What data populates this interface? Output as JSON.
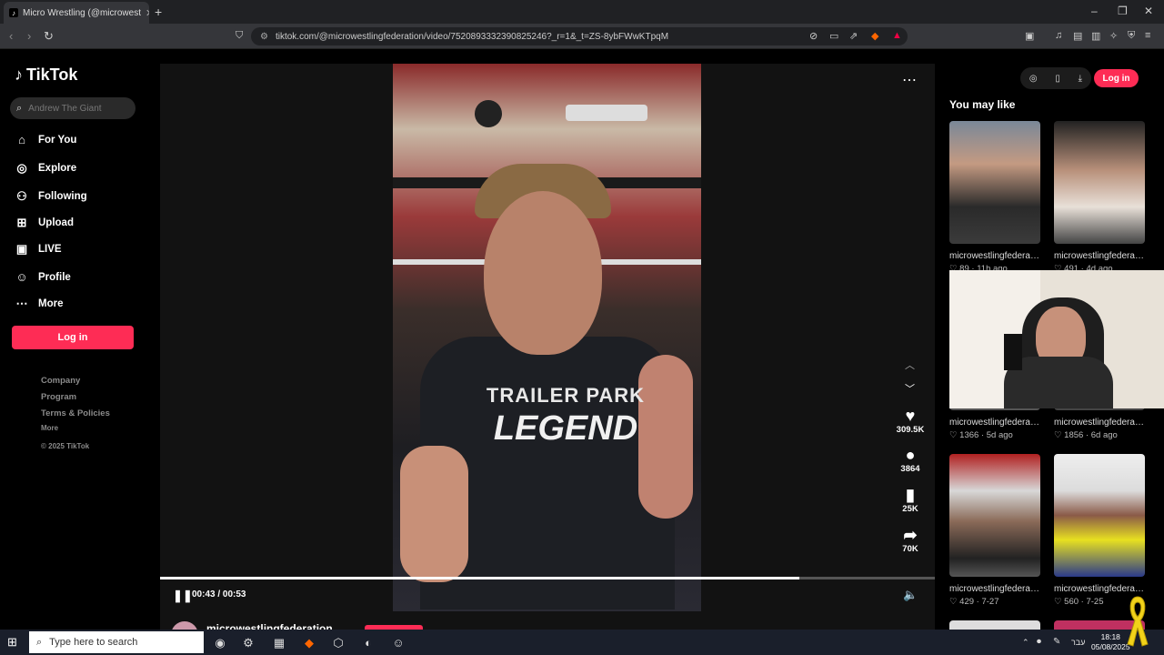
{
  "browser": {
    "tab_title": "Micro Wrestling (@microwest",
    "url": "tiktok.com/@microwestlingfederation/video/7520893332390825246?_r=1&_t=ZS-8ybFWwKTpqM"
  },
  "sidebar": {
    "brand": "TikTok",
    "search_placeholder": "Andrew The Giant",
    "nav": [
      {
        "label": "For You",
        "icon": "home-icon"
      },
      {
        "label": "Explore",
        "icon": "compass-icon"
      },
      {
        "label": "Following",
        "icon": "person-icon"
      },
      {
        "label": "Upload",
        "icon": "plus-square-icon"
      },
      {
        "label": "LIVE",
        "icon": "tv-icon"
      },
      {
        "label": "Profile",
        "icon": "profile-icon"
      },
      {
        "label": "More",
        "icon": "dots-icon"
      }
    ],
    "login_label": "Log in",
    "footer": [
      "Company",
      "Program",
      "Terms & Policies",
      "More",
      "© 2025 TikTok"
    ]
  },
  "video": {
    "shirt_line1": "TRAILER PARK",
    "shirt_line2": "LEGEND",
    "likes": "309.5K",
    "comments": "3864",
    "saves": "25K",
    "shares": "70K",
    "time": "00:43 / 00:53",
    "progress_fraction": 0.825,
    "author": "microwestlingfederation"
  },
  "right": {
    "login_label": "Log in",
    "heading": "You may like",
    "cards": [
      {
        "title": "microwestlingfederati...",
        "likes": "89",
        "ago": "11h ago"
      },
      {
        "title": "microwestlingfederati...",
        "likes": "491",
        "ago": "4d ago"
      },
      {
        "title": "microwestlingfederati...",
        "likes": "1366",
        "ago": "5d ago"
      },
      {
        "title": "microwestlingfederati...",
        "likes": "1856",
        "ago": "6d ago"
      },
      {
        "title": "microwestlingfederati...",
        "likes": "429",
        "ago": "7-27"
      },
      {
        "title": "microwestlingfederati...",
        "likes": "560",
        "ago": "7-25"
      }
    ]
  },
  "taskbar": {
    "search_placeholder": "Type here to search",
    "lang": "עבר",
    "time": "18:18",
    "date": "05/08/2025"
  },
  "colors": {
    "accent": "#fe2c55",
    "background": "#000000"
  }
}
